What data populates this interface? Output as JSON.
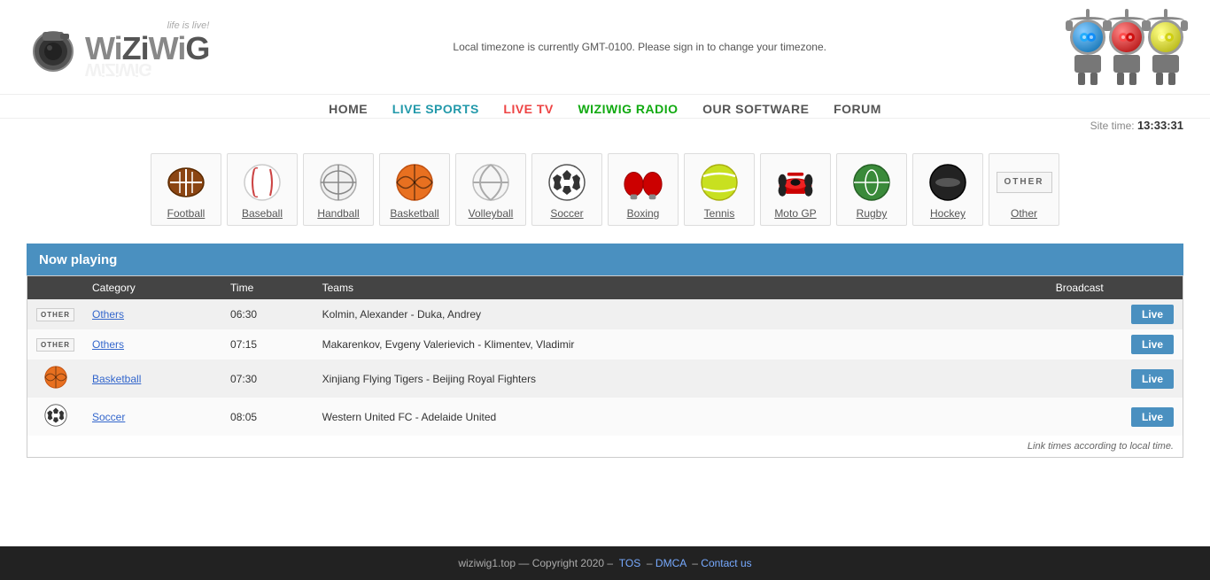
{
  "header": {
    "tagline": "life is live!",
    "timezone_msg": "Local timezone is currently GMT-0100. Please sign in to change your timezone.",
    "logo_text": "WiZiWiG"
  },
  "nav": {
    "items": [
      {
        "label": "HOME",
        "class": "home",
        "href": "#"
      },
      {
        "label": "LIVE SPORTS",
        "class": "live-sports",
        "href": "#"
      },
      {
        "label": "LIVE TV",
        "class": "live-tv",
        "href": "#"
      },
      {
        "label": "WIZIWIG RADIO",
        "class": "wiziwig-radio",
        "href": "#"
      },
      {
        "label": "OUR SOFTWARE",
        "class": "our-software",
        "href": "#"
      },
      {
        "label": "FORUM",
        "class": "forum",
        "href": "#"
      }
    ],
    "site_time_label": "Site time:",
    "site_time_value": "13:33:31"
  },
  "sports": [
    {
      "id": "football",
      "label": "Football"
    },
    {
      "id": "baseball",
      "label": "Baseball"
    },
    {
      "id": "handball",
      "label": "Handball"
    },
    {
      "id": "basketball",
      "label": "Basketball"
    },
    {
      "id": "volleyball",
      "label": "Volleyball"
    },
    {
      "id": "soccer",
      "label": "Soccer"
    },
    {
      "id": "boxing",
      "label": "Boxing"
    },
    {
      "id": "tennis",
      "label": "Tennis"
    },
    {
      "id": "motogp",
      "label": "Moto GP"
    },
    {
      "id": "rugby",
      "label": "Rugby"
    },
    {
      "id": "hockey",
      "label": "Hockey"
    },
    {
      "id": "other",
      "label": "Other"
    }
  ],
  "now_playing": {
    "section_label": "Now playing",
    "columns": [
      "Category",
      "Time",
      "Teams",
      "Broadcast"
    ],
    "rows": [
      {
        "category_icon": "other",
        "category_label": "Others",
        "time": "06:30",
        "teams": "Kolmin, Alexander - Duka, Andrey",
        "has_live": true,
        "live_label": "Live"
      },
      {
        "category_icon": "other",
        "category_label": "Others",
        "time": "07:15",
        "teams": "Makarenkov, Evgeny Valerievich - Klimentev, Vladimir",
        "has_live": true,
        "live_label": "Live"
      },
      {
        "category_icon": "basketball",
        "category_label": "Basketball",
        "time": "07:30",
        "teams": "Xinjiang Flying Tigers - Beijing Royal Fighters",
        "has_live": true,
        "live_label": "Live"
      },
      {
        "category_icon": "soccer",
        "category_label": "Soccer",
        "time": "08:05",
        "teams": "Western United FC - Adelaide United",
        "has_live": true,
        "live_label": "Live"
      }
    ],
    "footer_note": "Link times according to local time."
  },
  "footer": {
    "text": "wiziwig1.top — Copyright 2020 –",
    "links": [
      {
        "label": "TOS",
        "href": "#"
      },
      {
        "label": "DMCA",
        "href": "#"
      },
      {
        "label": "Contact us",
        "href": "#"
      }
    ]
  }
}
